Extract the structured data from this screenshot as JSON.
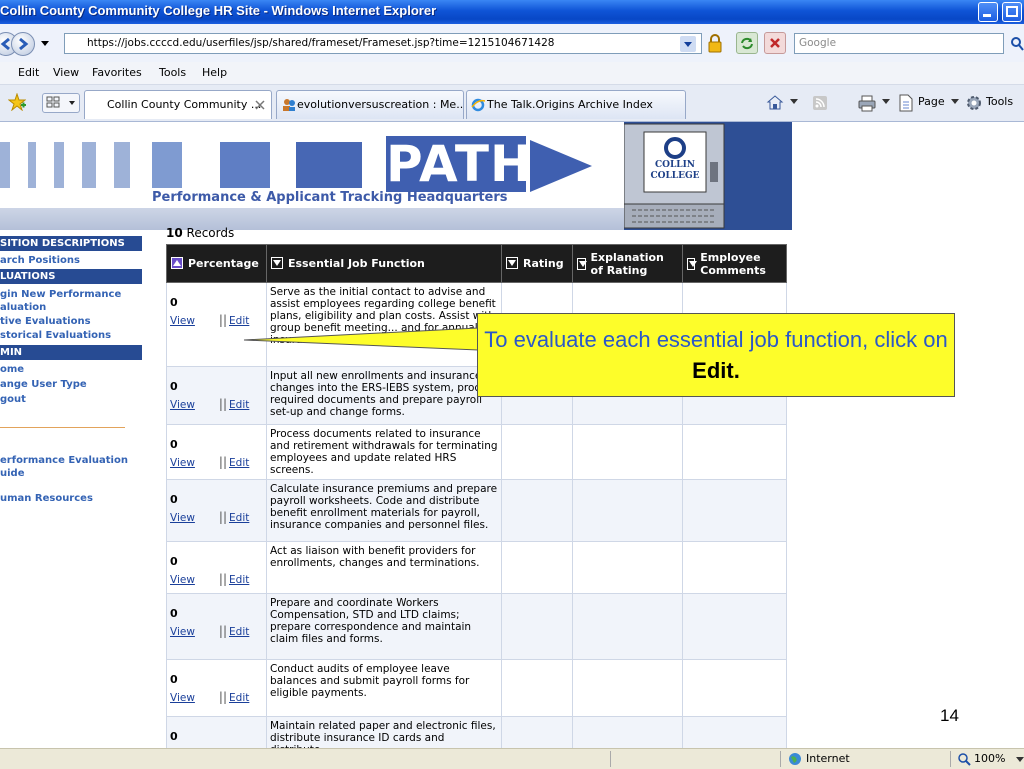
{
  "window": {
    "title": "Collin County Community College HR Site - Windows Internet Explorer"
  },
  "address": {
    "url": "https://jobs.ccccd.edu/userfiles/jsp/shared/frameset/Frameset.jsp?time=1215104671428",
    "search_placeholder": "Google"
  },
  "menu": [
    "Edit",
    "View",
    "Favorites",
    "Tools",
    "Help"
  ],
  "tabs": [
    {
      "label": "Collin County Community ..."
    },
    {
      "label": "evolutionversuscreation : Me..."
    },
    {
      "label": "The Talk.Origins Archive Index"
    }
  ],
  "toolbar": {
    "page_label": "Page",
    "tools_label": "Tools"
  },
  "banner": {
    "logo_word": "PATH",
    "tagline": "Performance & Applicant Tracking Headquarters",
    "college_top": "COLLIN",
    "college_bottom": "COLLEGE"
  },
  "sidebar": {
    "position_descriptions": "SITION DESCRIPTIONS",
    "search_positions": "arch Positions",
    "evaluations": "LUATIONS",
    "begin_eval_1": "gin New Performance",
    "begin_eval_2": "aluation",
    "active_evals": "tive Evaluations",
    "historical_evals": "storical Evaluations",
    "admin": "MIN",
    "home": "ome",
    "change_user": "ange User Type",
    "logout": "gout",
    "guide_1": "erformance Evaluation",
    "guide_2": "uide",
    "human_resources": "uman Resources"
  },
  "grid": {
    "record_count": "10",
    "records_label": "Records",
    "headers": {
      "percentage": "Percentage",
      "function": "Essential Job Function",
      "rating": "Rating",
      "explanation": "Explanation of Rating",
      "comments": "Employee Comments"
    },
    "view_label": "View",
    "edit_label": "Edit",
    "sep": "||",
    "rows": [
      {
        "pct": "0",
        "fn": "Serve as the initial contact to advise and assist employees regarding college benefit plans, eligibility and plan costs. Assist with group benefit meeting... and for annual insurance enrollment opportunities."
      },
      {
        "pct": "0",
        "fn": "Input all new enrollments and insurance changes into the ERS-IEBS system, process required documents and prepare payroll set-up and change forms."
      },
      {
        "pct": "0",
        "fn": "Process documents related to insurance and retirement withdrawals for terminating employees and update related HRS screens."
      },
      {
        "pct": "0",
        "fn": "Calculate insurance premiums and prepare payroll worksheets. Code and distribute benefit enrollment materials for payroll, insurance companies and personnel files."
      },
      {
        "pct": "0",
        "fn": "Act as liaison with benefit providers for enrollments, changes and terminations."
      },
      {
        "pct": "0",
        "fn": "Prepare and coordinate Workers Compensation, STD and LTD claims; prepare correspondence and maintain claim files and forms."
      },
      {
        "pct": "0",
        "fn": "Conduct audits of employee leave balances and submit payroll forms for eligible payments."
      },
      {
        "pct": "0",
        "fn": "Maintain related paper and electronic files, distribute insurance ID cards and distribute"
      }
    ]
  },
  "callout": {
    "text": "To evaluate each essential job function, click on",
    "bold": "Edit."
  },
  "slide_number": "14",
  "status": {
    "zone": "Internet",
    "zoom": "100%"
  },
  "colors": {
    "title_bar": "#0f54d6",
    "callout": "#fdfd2a",
    "header": "#1d1d1d",
    "sidebar_head": "#274b93"
  }
}
